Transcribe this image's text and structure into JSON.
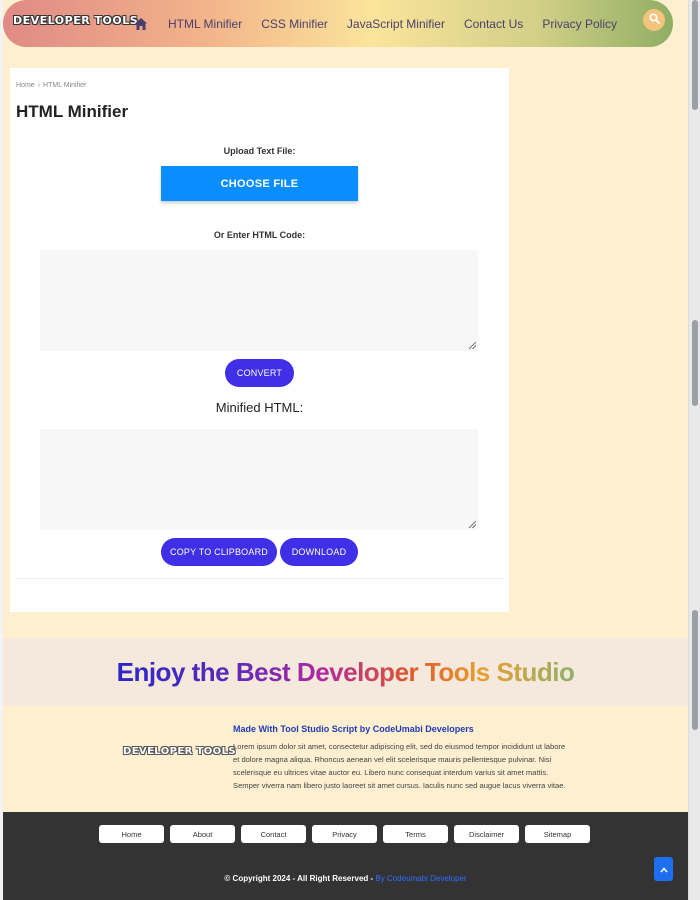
{
  "header": {
    "logo": "DEVELOPER TOOLS",
    "nav": [
      "HTML Minifier",
      "CSS Minifier",
      "JavaScript Minifier",
      "Contact Us",
      "Privacy Policy"
    ],
    "home_icon": "home-icon",
    "search_icon": "search-icon"
  },
  "breadcrumb": {
    "home": "Home",
    "sep": "›",
    "current": "HTML Minifier"
  },
  "tool": {
    "title": "HTML Minifier",
    "upload_label": "Upload Text File:",
    "choose_file": "CHOOSE FILE",
    "or_label": "Or Enter HTML Code:",
    "input_value": "",
    "convert": "CONVERT",
    "minified_title": "Minified HTML:",
    "output_value": "",
    "copy": "COPY TO CLIPBOARD",
    "download": "DOWNLOAD"
  },
  "promo": {
    "text": "Enjoy the Best Developer Tools Studio"
  },
  "info": {
    "logo": "DEVELOPER TOOLS",
    "heading": "Made With Tool Studio Script by CodeUmabi Developers",
    "body": "Lorem ipsum dolor sit amet, consectetur adipiscing elit, sed do eiusmod tempor incididunt ut labore et dolore magna aliqua. Rhoncus aenean vel elit scelerisque mauris pellentesque pulvinar. Nisi scelerisque eu ultrices vitae auctor eu. Libero nunc consequat interdum varius sit amet mattis. Semper viverra nam libero justo laoreet sit amet cursus. Iaculis nunc sed augue lacus viverra vitae."
  },
  "footer": {
    "links": [
      "Home",
      "About",
      "Contact",
      "Privacy",
      "Terms",
      "Disclaimer",
      "Sitemap"
    ],
    "copyright": "© Copyright 2024 - All Right Reserved - ",
    "by": "By Codeumabi Developer",
    "to_top_icon": "chevron-up-icon"
  },
  "colors": {
    "primary_button": "#3f2fe6",
    "choose_button": "#0a8dff",
    "to_top": "#1e6ff0"
  }
}
